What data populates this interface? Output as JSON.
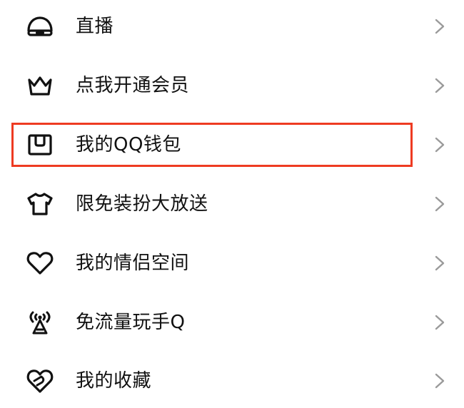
{
  "menu": {
    "items": [
      {
        "label": "直播",
        "icon": "live-icon"
      },
      {
        "label": "点我开通会员",
        "icon": "crown-icon"
      },
      {
        "label": "我的QQ钱包",
        "icon": "wallet-icon"
      },
      {
        "label": "限免装扮大放送",
        "icon": "tshirt-icon"
      },
      {
        "label": "我的情侣空间",
        "icon": "heart-icon"
      },
      {
        "label": "免流量玩手Q",
        "icon": "signal-tower-icon"
      },
      {
        "label": "我的收藏",
        "icon": "favorite-icon"
      }
    ],
    "chevron_icon": "chevron-right-icon",
    "highlighted_item": "我的QQ钱包"
  },
  "colors": {
    "text": "#111111",
    "icon": "#111111",
    "chevron": "#9a9a9a",
    "highlight_border": "#ee3b22",
    "background": "#ffffff"
  }
}
